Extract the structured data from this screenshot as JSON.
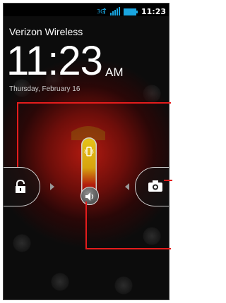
{
  "status_bar": {
    "time": "11:23",
    "icons": [
      "3g-data-icon",
      "signal-strength-icon",
      "battery-icon"
    ],
    "accent_color": "#1aa6e0"
  },
  "lockscreen": {
    "carrier": "Verizon Wireless",
    "clock": "11:23",
    "ampm": "AM",
    "date": "Thursday, February 16"
  },
  "controls": {
    "unlock_icon": "padlock-icon",
    "camera_icon": "camera-icon",
    "vibrate_icon": "vibrate-icon",
    "sound_icon": "speaker-icon"
  },
  "colors": {
    "callout": "#e51c1c",
    "glow": "#b11a10"
  }
}
